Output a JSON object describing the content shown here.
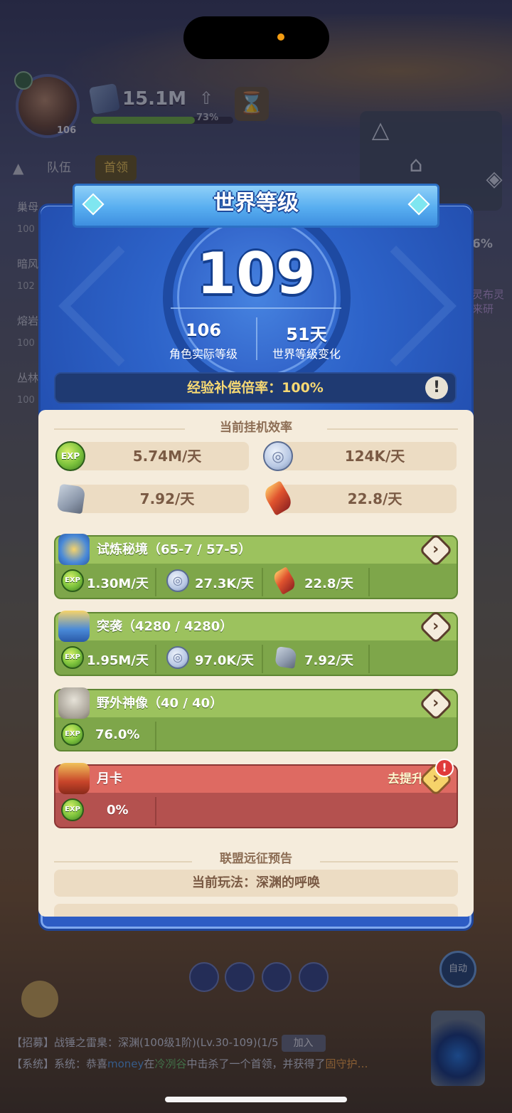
{
  "hud": {
    "avatar_level": "106",
    "power": "15.1M",
    "power_pct": "73%",
    "power_progress": 0.73,
    "tabs": [
      "队伍",
      "首领"
    ],
    "bg_pct": "6%",
    "bg_side_text": [
      "灵布灵",
      "来研"
    ],
    "bg_list": [
      {
        "name": "巢母",
        "val": "100"
      },
      {
        "name": "暗风",
        "val": "102"
      },
      {
        "name": "熔岩",
        "val": "100"
      },
      {
        "name": "丛林",
        "val": "100"
      }
    ]
  },
  "modal": {
    "title": "世界等级",
    "world_level": "109",
    "actual_level_value": "106",
    "actual_level_label": "角色实际等级",
    "change_value": "51天",
    "change_label": "世界等级变化",
    "exp_rate": "经验补偿倍率：100%",
    "alert_icon": "!"
  },
  "efficiency": {
    "title": "当前挂机效率",
    "items": [
      {
        "icon": "exp-icon",
        "value": "5.74M/天"
      },
      {
        "icon": "coin-icon",
        "value": "124K/天"
      },
      {
        "icon": "ore-icon",
        "value": "7.92/天"
      },
      {
        "icon": "crystal-icon",
        "value": "22.8/天"
      }
    ]
  },
  "cards": {
    "trial": {
      "title": "试炼秘境（65-7 / 57-5）",
      "cells": [
        "1.30M/天",
        "27.3K/天",
        "22.8/天"
      ]
    },
    "raid": {
      "title": "突袭（4280 / 4280）",
      "cells": [
        "1.95M/天",
        "97.0K/天",
        "7.92/天"
      ]
    },
    "statue": {
      "title": "野外神像（40 / 40）",
      "cells": [
        "76.0%"
      ]
    },
    "monthly": {
      "title": "月卡",
      "cta": "去提升",
      "badge": "!",
      "cells": [
        "0%"
      ]
    }
  },
  "alliance": {
    "title": "联盟远征预告",
    "current_play": "当前玩法：深渊的呼唤"
  },
  "chat": {
    "line1_prefix": "【招募】战锤之雷臬：",
    "line1_body": "深渊(100级1阶)(Lv.30-109)(1/5",
    "join_label": "加入",
    "line2_prefix": "【系统】系统：恭喜",
    "line2_name": "money",
    "line2_mid": "在",
    "line2_place": "冷冽谷",
    "line2_rest": "中击杀了一个首领，并获得了",
    "line2_item": "固守护…"
  },
  "auto_label": "自动",
  "colors": {
    "modal_blue": "#2d5cc4",
    "panel_cream": "#f5ecdc",
    "card_green": "#7ea64a",
    "card_red": "#b4514f",
    "exp_gold": "#f6d873"
  }
}
